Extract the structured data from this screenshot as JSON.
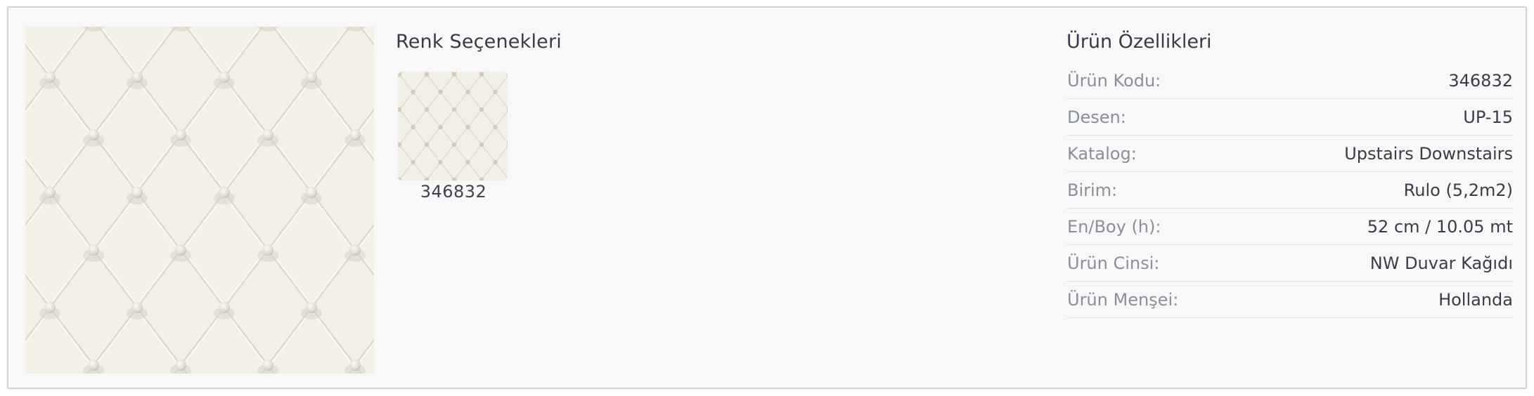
{
  "colors": {
    "title": "Renk Seçenekleri",
    "options": [
      {
        "code": "346832",
        "icon": "tufted-wallpaper-swatch"
      }
    ]
  },
  "main_image": {
    "icon": "tufted-cream-wallpaper-pattern"
  },
  "specs": {
    "title": "Ürün Özellikleri",
    "rows": [
      {
        "label": "Ürün Kodu:",
        "value": "346832"
      },
      {
        "label": "Desen:",
        "value": "UP-15"
      },
      {
        "label": "Katalog:",
        "value": "Upstairs Downstairs"
      },
      {
        "label": "Birim:",
        "value": "Rulo (5,2m2)"
      },
      {
        "label": "En/Boy (h):",
        "value": "52 cm / 10.05 mt"
      },
      {
        "label": "Ürün Cinsi:",
        "value": "NW Duvar Kağıdı"
      },
      {
        "label": "Ürün Menşei:",
        "value": "Hollanda"
      }
    ]
  },
  "theme": {
    "card_background": "#f8f8f8",
    "pattern_color": "#f2efe3",
    "label_color": "#8a8f9b",
    "value_color": "#3a3c48"
  }
}
